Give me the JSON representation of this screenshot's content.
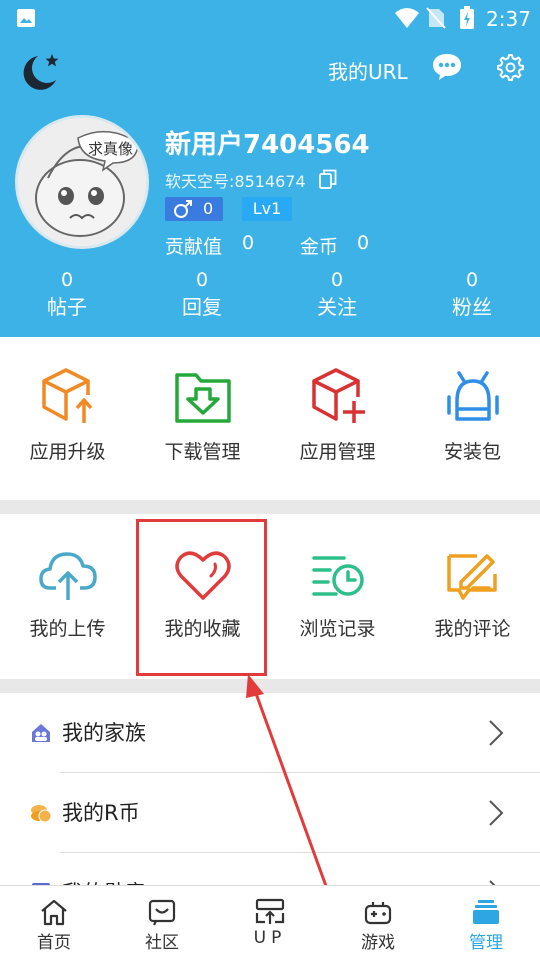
{
  "status_bar": {
    "time": "2:37"
  },
  "header": {
    "url_label": "我的URL",
    "avatar_text": "求真像",
    "username": "新用户7404564",
    "sky_id": "软天空号:8514674",
    "gender_count": "0",
    "level": "Lv1",
    "contribution_label": "贡献值",
    "contribution_value": "0",
    "coins_label": "金币",
    "coins_value": "0",
    "stats": [
      {
        "value": "0",
        "label": "帖子"
      },
      {
        "value": "0",
        "label": "回复"
      },
      {
        "value": "0",
        "label": "关注"
      },
      {
        "value": "0",
        "label": "粉丝"
      }
    ]
  },
  "tools": [
    {
      "label": "应用升级",
      "icon": "box-upload-icon",
      "color": "#f08a24"
    },
    {
      "label": "下载管理",
      "icon": "folder-download-icon",
      "color": "#25a83a"
    },
    {
      "label": "应用管理",
      "icon": "box-add-icon",
      "color": "#d93232"
    },
    {
      "label": "安装包",
      "icon": "android-icon",
      "color": "#2f8fe8"
    }
  ],
  "personal": [
    {
      "label": "我的上传",
      "icon": "cloud-upload-icon",
      "color": "#4aa8c8"
    },
    {
      "label": "我的收藏",
      "icon": "heart-icon",
      "color": "#e23b3b"
    },
    {
      "label": "浏览记录",
      "icon": "history-list-icon",
      "color": "#2dbf8a"
    },
    {
      "label": "我的评论",
      "icon": "comment-pen-icon",
      "color": "#f0a020"
    }
  ],
  "menu": [
    {
      "label": "我的家族",
      "icon": "family-icon"
    },
    {
      "label": "我的R币",
      "icon": "r-coin-icon"
    },
    {
      "label": "我的勋章",
      "icon": "medal-icon"
    }
  ],
  "tabs": [
    {
      "label": "首页",
      "icon": "home-icon"
    },
    {
      "label": "社区",
      "icon": "community-icon"
    },
    {
      "label": "UP",
      "icon": "up-icon"
    },
    {
      "label": "游戏",
      "icon": "gamepad-icon"
    },
    {
      "label": "管理",
      "icon": "manage-icon",
      "active": true
    }
  ],
  "accent_color": "#3cb2e6",
  "highlight_color": "#e23b3b"
}
